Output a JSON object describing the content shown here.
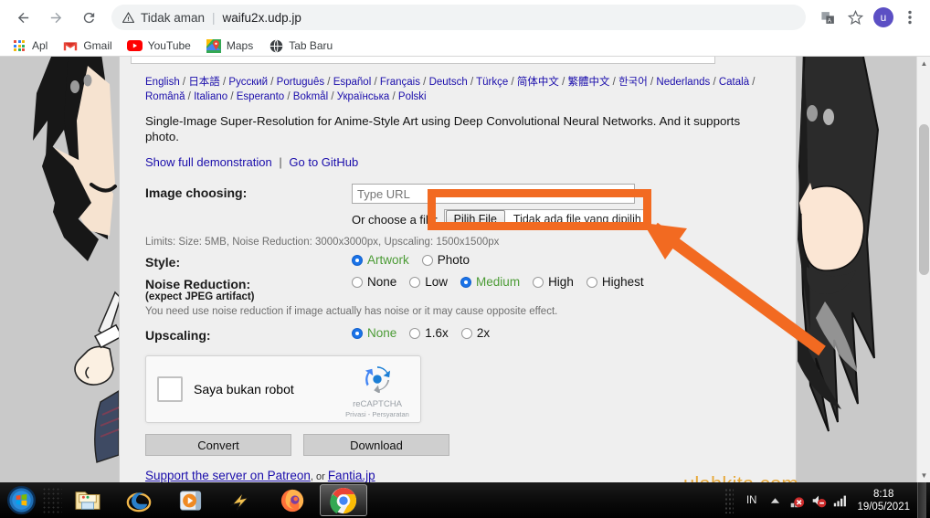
{
  "browser": {
    "back_icon": "back-arrow-icon",
    "forward_icon": "forward-arrow-icon",
    "reload_icon": "reload-icon",
    "security_label": "Tidak aman",
    "url": "waifu2x.udp.jp",
    "translate_icon": "translate-icon",
    "bookmark_icon": "star-icon",
    "avatar_initial": "u",
    "menu_icon": "kebab-menu-icon",
    "bookmarks": [
      {
        "label": "Apl",
        "icon": "apps-grid-icon"
      },
      {
        "label": "Gmail",
        "icon": "gmail-icon"
      },
      {
        "label": "YouTube",
        "icon": "youtube-icon"
      },
      {
        "label": "Maps",
        "icon": "maps-icon"
      },
      {
        "label": "Tab Baru",
        "icon": "globe-icon"
      }
    ]
  },
  "page": {
    "languages": [
      "English",
      "日本語",
      "Русский",
      "Português",
      "Español",
      "Français",
      "Deutsch",
      "Türkçe",
      "简体中文",
      "繁體中文",
      "한국어",
      "Nederlands",
      "Català",
      "Română",
      "Italiano",
      "Esperanto",
      "Bokmål",
      "Українська",
      "Polski"
    ],
    "language_separator": "/",
    "tagline": "Single-Image Super-Resolution for Anime-Style Art using Deep Convolutional Neural Networks. And it supports photo.",
    "demo_link": "Show full demonstration",
    "demo_separator": "|",
    "github_link": "Go to GitHub",
    "image_choosing_label": "Image choosing:",
    "url_placeholder": "Type URL",
    "or_choose_label": "Or choose a file:",
    "file_button_label": "Pilih File",
    "file_name_label": "Tidak ada file yang dipilih",
    "limits": "Limits: Size: 5MB, Noise Reduction: 3000x3000px, Upscaling: 1500x1500px",
    "style_label": "Style:",
    "style_options": [
      {
        "label": "Artwork",
        "selected": true
      },
      {
        "label": "Photo",
        "selected": false
      }
    ],
    "noise_label": "Noise Reduction:",
    "noise_sub_label": "(expect JPEG artifact)",
    "noise_options": [
      {
        "label": "None",
        "selected": false
      },
      {
        "label": "Low",
        "selected": false
      },
      {
        "label": "Medium",
        "selected": true
      },
      {
        "label": "High",
        "selected": false
      },
      {
        "label": "Highest",
        "selected": false
      }
    ],
    "noise_hint": "You need use noise reduction if image actually has noise or it may cause opposite effect.",
    "upscaling_label": "Upscaling:",
    "upscaling_options": [
      {
        "label": "None",
        "selected": true
      },
      {
        "label": "1.6x",
        "selected": false
      },
      {
        "label": "2x",
        "selected": false
      }
    ],
    "captcha_label": "Saya bukan robot",
    "captcha_brand": "reCAPTCHA",
    "captcha_privacy": "Privasi",
    "captcha_dot": "-",
    "captcha_terms": "Persyaratan",
    "convert_label": "Convert",
    "download_label": "Download",
    "support_link": "Support the server on Patreon",
    "support_or": ", or ",
    "fantia_link": "Fantia.jp",
    "watermark": "ulahkita.com"
  },
  "annotation": {
    "highlight_color": "#f26a21",
    "arrow_icon": "arrow-pointing-to-file-input"
  },
  "taskbar": {
    "start_icon": "windows-start-orb-icon",
    "items": [
      {
        "icon": "file-explorer-icon",
        "active": false
      },
      {
        "icon": "internet-explorer-icon",
        "active": false
      },
      {
        "icon": "windows-media-player-icon",
        "active": false
      },
      {
        "icon": "winamp-icon",
        "active": false
      },
      {
        "icon": "firefox-icon",
        "active": false
      },
      {
        "icon": "google-chrome-icon",
        "active": true
      }
    ],
    "language_indicator": "IN",
    "show_hidden_icon": "chevron-up-icon",
    "tray_icons": [
      {
        "icon": "network-error-icon"
      },
      {
        "icon": "volume-muted-icon"
      },
      {
        "icon": "signal-bars-icon"
      }
    ],
    "time": "8:18",
    "date": "19/05/2021"
  }
}
